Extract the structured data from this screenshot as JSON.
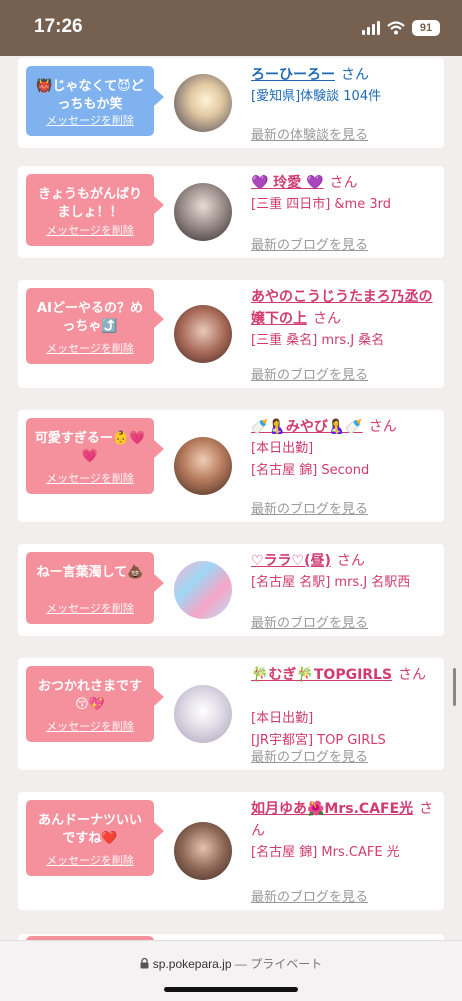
{
  "status_bar": {
    "time": "17:26",
    "battery": "91"
  },
  "browser": {
    "url": "sp.pokepara.jp",
    "mode": "— プライベート"
  },
  "colors": {
    "bubble_pink": "#f5919d",
    "bubble_blue": "#7fb2ee",
    "link_blue": "#1d6ab3",
    "link_pink": "#d23b6f"
  },
  "delete_label": "メッセージを削除",
  "cards": [
    {
      "message": "👹じゃなくて😈どっちもか笑",
      "bubble": "blue",
      "name": "ろーひーろー",
      "name_color": "#1d6ab3",
      "san": "さん",
      "info_color": "#1d6ab3",
      "info": [
        "[愛知県]体験談 104件"
      ],
      "more": "最新の体験談を見る",
      "avatar_icon": "sunset-photo"
    },
    {
      "message": "きょうもがんばりましょ！！",
      "bubble": "pink",
      "name": "💜 玲愛 💜",
      "name_color": "#d23b6f",
      "san": "さん",
      "info_color": "#d23b6f",
      "info": [
        "[三重 四日市] &me 3rd"
      ],
      "more": "最新のブログを見る",
      "avatar_icon": "girl-photo"
    },
    {
      "message": "AIどーやるの？めっちゃ⤴️",
      "bubble": "pink",
      "name": "あやのこうじうたまろ乃丞の嬢下の上",
      "name_color": "#d23b6f",
      "san": "さん",
      "info_color": "#d23b6f",
      "info": [
        "[三重 桑名] mrs.J 桑名"
      ],
      "more": "最新のブログを見る",
      "avatar_icon": "girl-photo"
    },
    {
      "message": "可愛すぎるー👶💗💗",
      "bubble": "pink",
      "name": "🍼🤱みやび🤱🍼",
      "name_color": "#d23b6f",
      "san": "さん",
      "info_color": "#d23b6f",
      "info": [
        "[本日出勤]",
        "[名古屋 錦] Second"
      ],
      "more": "最新のブログを見る",
      "avatar_icon": "girl-photo"
    },
    {
      "message": "ねー言葉濁して💩",
      "bubble": "pink",
      "name": "♡ララ♡(昼)",
      "name_color": "#d23b6f",
      "san": "さん",
      "info_color": "#d23b6f",
      "info": [
        "[名古屋 名駅] mrs.J 名駅西"
      ],
      "more": "最新のブログを見る",
      "avatar_icon": "girl-photo"
    },
    {
      "message": "おつかれさまです😚💖",
      "bubble": "pink",
      "name": "🎋むぎ🎋TOPGIRLS",
      "name_color": "#d23b6f",
      "san": "さん",
      "info_color": "#d23b6f",
      "info": [
        "[本日出勤]",
        "[JR宇都宮] TOP GIRLS"
      ],
      "more": "最新のブログを見る",
      "avatar_icon": "girl-photo"
    },
    {
      "message": "あんドーナツいいですね❤️",
      "bubble": "pink",
      "name": "如月ゆあ🌺Mrs.CAFE光",
      "name_color": "#d23b6f",
      "san": "さん",
      "info_color": "#d23b6f",
      "info": [
        "[名古屋 錦] Mrs.CAFE 光"
      ],
      "more": "最新のブログを見る",
      "avatar_icon": "girl-photo"
    }
  ]
}
